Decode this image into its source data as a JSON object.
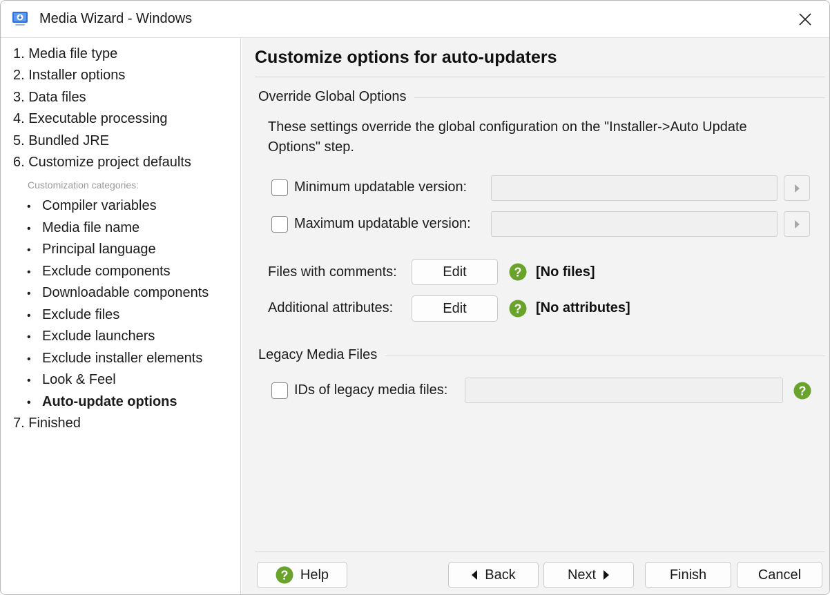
{
  "window": {
    "title": "Media Wizard - Windows"
  },
  "sidebar": {
    "steps_top": [
      {
        "label": "1. Media file type"
      },
      {
        "label": "2. Installer options"
      },
      {
        "label": "3. Data files"
      },
      {
        "label": "4. Executable processing"
      },
      {
        "label": "5. Bundled JRE"
      },
      {
        "label": "6. Customize project defaults"
      }
    ],
    "categories_caption": "Customization categories:",
    "categories": [
      {
        "label": "Compiler variables"
      },
      {
        "label": "Media file name"
      },
      {
        "label": "Principal language"
      },
      {
        "label": "Exclude components"
      },
      {
        "label": "Downloadable components"
      },
      {
        "label": "Exclude files"
      },
      {
        "label": "Exclude launchers"
      },
      {
        "label": "Exclude installer elements"
      },
      {
        "label": "Look & Feel"
      },
      {
        "label": "Auto-update options",
        "active": true
      }
    ],
    "bullet": "•",
    "steps_bottom": [
      {
        "label": "7. Finished"
      }
    ]
  },
  "main": {
    "title": "Customize options for auto-updaters",
    "override_group": {
      "title": "Override Global Options",
      "description": "These settings override the global configuration on the \"Installer->Auto Update Options\" step.",
      "min_version": {
        "label": "Minimum updatable version:",
        "value": "",
        "checked": false
      },
      "max_version": {
        "label": "Maximum updatable version:",
        "value": "",
        "checked": false
      },
      "files_with_comments": {
        "label": "Files with comments:",
        "button": "Edit",
        "status": "[No files]"
      },
      "additional_attributes": {
        "label": "Additional attributes:",
        "button": "Edit",
        "status": "[No attributes]"
      }
    },
    "legacy_group": {
      "title": "Legacy Media Files",
      "ids": {
        "label": "IDs of legacy media files:",
        "value": "",
        "checked": false
      }
    }
  },
  "footer": {
    "help": "Help",
    "back": "Back",
    "next": "Next",
    "finish": "Finish",
    "cancel": "Cancel"
  },
  "icons": {
    "app": "media-wizard-icon",
    "close": "close-icon",
    "help": "help-icon",
    "arrow": "triangle-right-icon"
  },
  "colors": {
    "help_green": "#6aa32b",
    "app_blue": "#2f6fdc",
    "content_bg": "#f3f3f3"
  }
}
